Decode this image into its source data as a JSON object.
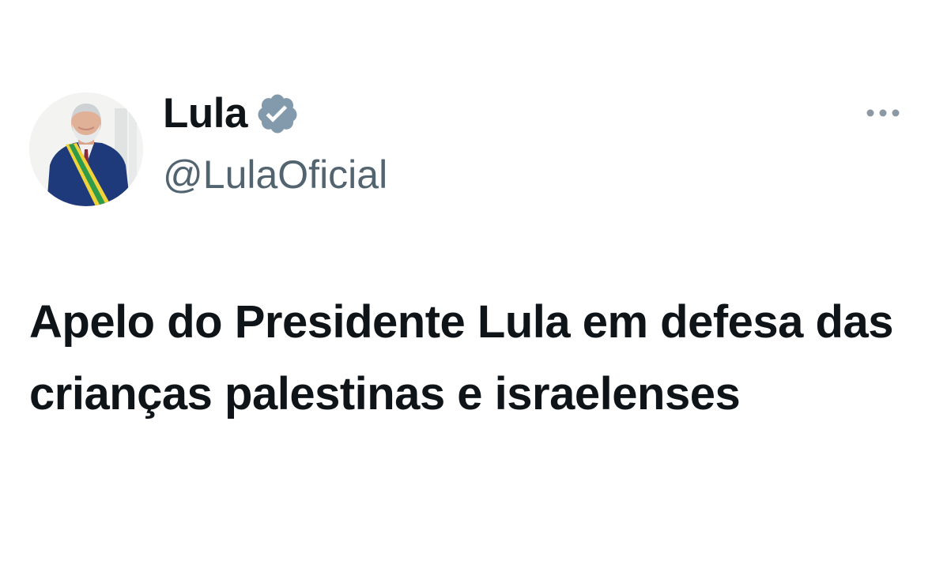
{
  "author": {
    "display_name": "Lula",
    "handle": "@LulaOficial",
    "verified": true,
    "verified_badge_color": "#829aab"
  },
  "tweet": {
    "text": "Apelo do Presidente Lula em defesa das crianças palestinas e israelenses"
  },
  "icons": {
    "verified": "verified-badge-icon",
    "more": "more-options-icon"
  },
  "colors": {
    "text_primary": "#0f1419",
    "text_secondary": "#536471",
    "icon_muted": "#8c99a5"
  }
}
